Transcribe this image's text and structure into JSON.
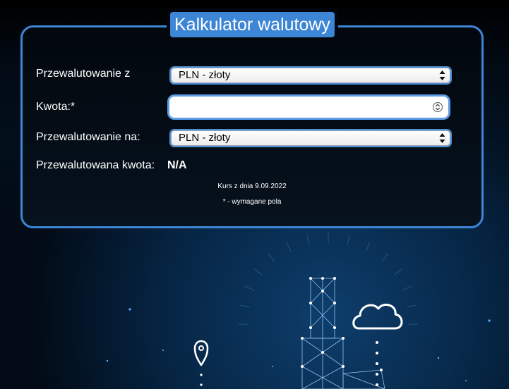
{
  "header": {
    "title": "Kalkulator walutowy"
  },
  "form": {
    "from_label": "Przewalutowanie z",
    "from_selected": "PLN - złoty",
    "amount_label": "Kwota:*",
    "amount_value": "",
    "to_label": "Przewalutowanie na:",
    "to_selected": "PLN - złoty",
    "result_label": "Przewalutowana kwota:",
    "result_value": "N/A"
  },
  "footer": {
    "rate_date": "Kurs z dnia 9.09.2022",
    "required_note": "* - wymagane pola"
  },
  "colors": {
    "accent": "#3d86d6",
    "background": "#000814",
    "panel": "#02070d"
  },
  "icons": {
    "select_arrows": "up-down-arrows-icon",
    "number_spin": "spin-stepper-icon",
    "cloud": "cloud-icon",
    "location_pin": "location-pin-icon"
  }
}
